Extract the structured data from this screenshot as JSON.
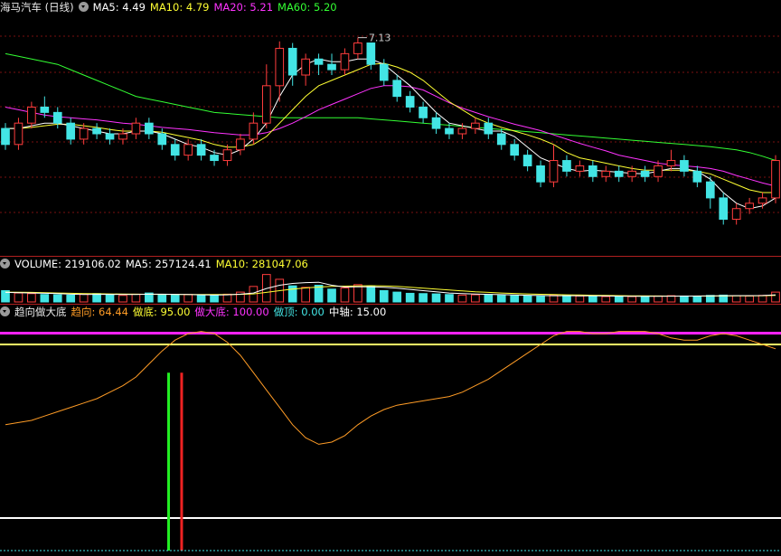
{
  "colors": {
    "up": "#ff3d3d",
    "down": "#43e5e5",
    "ma5": "#ffffff",
    "ma10": "#ffff33",
    "ma20": "#ff33ff",
    "ma60": "#33ff33",
    "trend": "#ff9c26",
    "grid": "#7a1010",
    "divider": "#b02020",
    "buy_signal": "#22ee22",
    "sell_signal": "#ee2222",
    "top_line": "#ffff66",
    "axis_line": "#ffffff",
    "pink_band": "#ff22ff"
  },
  "main_panel": {
    "title": "海马汽车 (日线)",
    "indicators": [
      {
        "label": "MA5: 4.49",
        "color": "#ffffff"
      },
      {
        "label": "MA10: 4.79",
        "color": "#ffff33"
      },
      {
        "label": "MA20: 5.21",
        "color": "#ff33ff"
      },
      {
        "label": "MA60: 5.20",
        "color": "#33ff33"
      }
    ],
    "high_label": "7.13"
  },
  "volume_panel": {
    "indicators": [
      {
        "label": "VOLUME: 219106.02",
        "color": "#ffffff"
      },
      {
        "label": "MA5: 257124.41",
        "color": "#ffffff"
      },
      {
        "label": "MA10: 281047.06",
        "color": "#ffff33"
      }
    ]
  },
  "indicator_panel": {
    "title": "趋向做大底",
    "indicators": [
      {
        "label": "趋向: 64.44",
        "color": "#ff9c26"
      },
      {
        "label": "做底: 95.00",
        "color": "#ffff33"
      },
      {
        "label": "做大底: 100.00",
        "color": "#ff33ff"
      },
      {
        "label": "做顶: 0.00",
        "color": "#43e5e5"
      },
      {
        "label": "中轴: 15.00",
        "color": "#ffffff"
      }
    ]
  },
  "chart_data": [
    {
      "type": "candlestick",
      "name": "price",
      "ylim": [
        3.2,
        7.6
      ],
      "candles": [
        [
          5.5,
          5.2,
          5.6,
          5.1
        ],
        [
          5.2,
          5.6,
          5.7,
          5.1
        ],
        [
          5.6,
          5.9,
          6.0,
          5.5
        ],
        [
          5.9,
          5.8,
          6.1,
          5.7
        ],
        [
          5.8,
          5.6,
          5.9,
          5.5
        ],
        [
          5.6,
          5.3,
          5.7,
          5.2
        ],
        [
          5.3,
          5.5,
          5.6,
          5.2
        ],
        [
          5.5,
          5.4,
          5.6,
          5.3
        ],
        [
          5.4,
          5.3,
          5.5,
          5.2
        ],
        [
          5.3,
          5.4,
          5.5,
          5.2
        ],
        [
          5.4,
          5.6,
          5.7,
          5.3
        ],
        [
          5.6,
          5.4,
          5.7,
          5.3
        ],
        [
          5.4,
          5.2,
          5.5,
          5.1
        ],
        [
          5.2,
          5.0,
          5.3,
          4.9
        ],
        [
          5.0,
          5.2,
          5.3,
          4.9
        ],
        [
          5.2,
          5.0,
          5.3,
          4.9
        ],
        [
          5.0,
          4.9,
          5.1,
          4.8
        ],
        [
          4.9,
          5.1,
          5.2,
          4.8
        ],
        [
          5.1,
          5.3,
          5.4,
          5.0
        ],
        [
          5.3,
          5.6,
          5.8,
          5.2
        ],
        [
          5.6,
          6.3,
          6.7,
          5.5
        ],
        [
          6.3,
          7.0,
          7.13,
          6.0
        ],
        [
          7.0,
          6.5,
          7.1,
          6.3
        ],
        [
          6.5,
          6.8,
          6.9,
          6.3
        ],
        [
          6.8,
          6.7,
          6.9,
          6.5
        ],
        [
          6.7,
          6.6,
          6.9,
          6.5
        ],
        [
          6.6,
          6.9,
          7.0,
          6.5
        ],
        [
          6.9,
          7.1,
          7.2,
          6.8
        ],
        [
          7.1,
          6.7,
          7.1,
          6.6
        ],
        [
          6.7,
          6.4,
          6.8,
          6.3
        ],
        [
          6.4,
          6.1,
          6.5,
          6.0
        ],
        [
          6.1,
          5.9,
          6.2,
          5.8
        ],
        [
          5.9,
          5.7,
          6.0,
          5.6
        ],
        [
          5.7,
          5.5,
          5.8,
          5.4
        ],
        [
          5.5,
          5.4,
          5.6,
          5.3
        ],
        [
          5.4,
          5.5,
          5.6,
          5.3
        ],
        [
          5.5,
          5.6,
          5.7,
          5.4
        ],
        [
          5.6,
          5.4,
          5.7,
          5.3
        ],
        [
          5.4,
          5.2,
          5.5,
          5.1
        ],
        [
          5.2,
          5.0,
          5.3,
          4.9
        ],
        [
          5.0,
          4.8,
          5.1,
          4.7
        ],
        [
          4.8,
          4.5,
          4.9,
          4.4
        ],
        [
          4.5,
          4.9,
          5.2,
          4.4
        ],
        [
          4.9,
          4.7,
          5.0,
          4.6
        ],
        [
          4.7,
          4.8,
          4.9,
          4.6
        ],
        [
          4.8,
          4.6,
          4.9,
          4.5
        ],
        [
          4.6,
          4.7,
          4.8,
          4.5
        ],
        [
          4.7,
          4.6,
          4.8,
          4.5
        ],
        [
          4.6,
          4.7,
          4.8,
          4.5
        ],
        [
          4.7,
          4.6,
          4.8,
          4.5
        ],
        [
          4.6,
          4.8,
          4.9,
          4.5
        ],
        [
          4.8,
          4.9,
          5.1,
          4.7
        ],
        [
          4.9,
          4.7,
          5.0,
          4.6
        ],
        [
          4.7,
          4.5,
          4.8,
          4.4
        ],
        [
          4.5,
          4.2,
          4.6,
          4.0
        ],
        [
          4.2,
          3.8,
          4.3,
          3.7
        ],
        [
          3.8,
          4.0,
          4.1,
          3.7
        ],
        [
          4.0,
          4.1,
          4.2,
          3.9
        ],
        [
          4.1,
          4.2,
          4.3,
          4.0
        ],
        [
          4.2,
          4.9,
          5.0,
          4.1
        ]
      ],
      "ma5": [
        5.5,
        5.5,
        5.55,
        5.6,
        5.6,
        5.55,
        5.5,
        5.45,
        5.4,
        5.4,
        5.45,
        5.45,
        5.4,
        5.3,
        5.2,
        5.15,
        5.05,
        5.0,
        5.1,
        5.3,
        5.6,
        6.1,
        6.5,
        6.7,
        6.8,
        6.75,
        6.75,
        6.8,
        6.8,
        6.7,
        6.5,
        6.3,
        6.05,
        5.8,
        5.6,
        5.55,
        5.5,
        5.45,
        5.45,
        5.35,
        5.15,
        4.95,
        4.85,
        4.75,
        4.7,
        4.72,
        4.7,
        4.68,
        4.66,
        4.65,
        4.7,
        4.75,
        4.75,
        4.7,
        4.55,
        4.3,
        4.1,
        4.0,
        4.05,
        4.2
      ],
      "ma10": [
        5.5,
        5.5,
        5.52,
        5.55,
        5.58,
        5.58,
        5.55,
        5.52,
        5.48,
        5.45,
        5.45,
        5.45,
        5.43,
        5.38,
        5.33,
        5.28,
        5.2,
        5.15,
        5.15,
        5.2,
        5.35,
        5.6,
        5.85,
        6.1,
        6.3,
        6.4,
        6.5,
        6.6,
        6.7,
        6.72,
        6.65,
        6.55,
        6.4,
        6.2,
        6.0,
        5.85,
        5.7,
        5.6,
        5.52,
        5.45,
        5.38,
        5.3,
        5.2,
        5.05,
        4.95,
        4.9,
        4.85,
        4.8,
        4.75,
        4.72,
        4.72,
        4.72,
        4.72,
        4.7,
        4.65,
        4.55,
        4.45,
        4.35,
        4.3,
        4.3
      ],
      "ma20": [
        5.9,
        5.85,
        5.8,
        5.75,
        5.72,
        5.7,
        5.68,
        5.66,
        5.63,
        5.6,
        5.58,
        5.55,
        5.52,
        5.5,
        5.48,
        5.45,
        5.42,
        5.4,
        5.38,
        5.38,
        5.42,
        5.5,
        5.6,
        5.72,
        5.85,
        5.95,
        6.05,
        6.15,
        6.25,
        6.3,
        6.3,
        6.28,
        6.22,
        6.1,
        5.98,
        5.88,
        5.8,
        5.72,
        5.65,
        5.58,
        5.52,
        5.46,
        5.38,
        5.3,
        5.22,
        5.15,
        5.08,
        5.0,
        4.95,
        4.9,
        4.85,
        4.82,
        4.8,
        4.78,
        4.75,
        4.7,
        4.62,
        4.55,
        4.48,
        4.42
      ],
      "ma60": [
        6.9,
        6.85,
        6.8,
        6.75,
        6.7,
        6.6,
        6.5,
        6.4,
        6.3,
        6.2,
        6.1,
        6.05,
        6.0,
        5.95,
        5.9,
        5.85,
        5.8,
        5.78,
        5.76,
        5.74,
        5.72,
        5.7,
        5.7,
        5.7,
        5.7,
        5.7,
        5.7,
        5.7,
        5.68,
        5.66,
        5.64,
        5.62,
        5.6,
        5.58,
        5.56,
        5.54,
        5.52,
        5.5,
        5.48,
        5.46,
        5.44,
        5.42,
        5.4,
        5.38,
        5.36,
        5.34,
        5.32,
        5.3,
        5.28,
        5.26,
        5.24,
        5.22,
        5.2,
        5.18,
        5.16,
        5.13,
        5.1,
        5.05,
        4.98,
        4.9
      ]
    },
    {
      "type": "bar",
      "name": "volume",
      "ylim": [
        0,
        1000000
      ],
      "values": [
        380000,
        300000,
        280000,
        250000,
        240000,
        230000,
        260000,
        280000,
        240000,
        220000,
        260000,
        300000,
        250000,
        230000,
        250000,
        220000,
        210000,
        260000,
        330000,
        520000,
        920000,
        760000,
        540000,
        490000,
        560000,
        430000,
        470000,
        580000,
        520000,
        380000,
        330000,
        290000,
        280000,
        270000,
        250000,
        230000,
        240000,
        250000,
        220000,
        210000,
        200000,
        190000,
        230000,
        210000,
        200000,
        190000,
        180000,
        190000,
        180000,
        190000,
        200000,
        210000,
        200000,
        190000,
        220000,
        230000,
        210000,
        200000,
        220000,
        330000
      ],
      "ma5": [
        320000,
        310000,
        300000,
        290000,
        280000,
        260000,
        250000,
        255000,
        255000,
        250000,
        250000,
        260000,
        260000,
        255000,
        250000,
        240000,
        230000,
        240000,
        260000,
        300000,
        450000,
        560000,
        620000,
        650000,
        660000,
        560000,
        500000,
        510000,
        510000,
        490000,
        460000,
        420000,
        380000,
        340000,
        300000,
        280000,
        265000,
        255000,
        245000,
        235000,
        225000,
        215000,
        210000,
        210000,
        205000,
        205000,
        200000,
        195000,
        190000,
        190000,
        190000,
        195000,
        198000,
        200000,
        205000,
        210000,
        212000,
        212000,
        215000,
        240000
      ],
      "ma10": [
        330000,
        325000,
        320000,
        310000,
        300000,
        290000,
        280000,
        275000,
        270000,
        265000,
        260000,
        258000,
        256000,
        255000,
        253000,
        250000,
        248000,
        250000,
        255000,
        270000,
        320000,
        380000,
        430000,
        470000,
        500000,
        520000,
        530000,
        540000,
        545000,
        540000,
        520000,
        490000,
        460000,
        430000,
        400000,
        370000,
        340000,
        320000,
        300000,
        285000,
        270000,
        258000,
        248000,
        240000,
        232000,
        225000,
        218000,
        212000,
        207000,
        203000,
        200000,
        198000,
        197000,
        197000,
        198000,
        200000,
        203000,
        206000,
        210000,
        220000
      ]
    },
    {
      "type": "line",
      "name": "趋向",
      "ylim": [
        0,
        105
      ],
      "values": [
        58,
        59,
        60,
        62,
        64,
        66,
        68,
        70,
        73,
        76,
        80,
        86,
        92,
        97,
        100,
        101,
        100,
        96,
        90,
        82,
        74,
        66,
        58,
        52,
        49,
        50,
        53,
        58,
        62,
        65,
        67,
        68,
        69,
        70,
        71,
        73,
        76,
        79,
        83,
        87,
        91,
        95,
        99,
        101,
        101,
        100,
        100,
        101,
        101,
        101,
        100,
        98,
        97,
        97,
        99,
        100,
        99,
        97,
        95,
        93
      ],
      "buy_signal_index": 12.5,
      "sell_signal_index": 13.5,
      "levels": {
        "top": 95,
        "big_bottom": 100,
        "axis": 15
      }
    }
  ]
}
